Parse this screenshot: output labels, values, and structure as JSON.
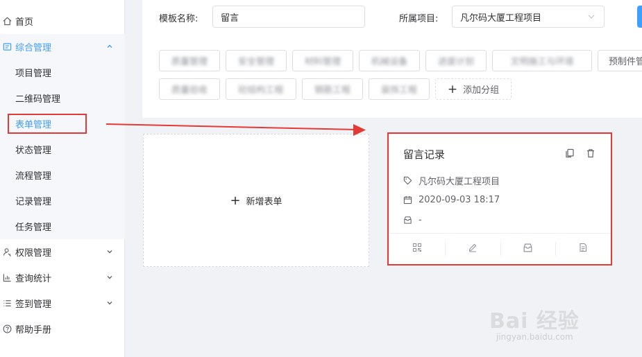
{
  "sidebar": {
    "items": [
      {
        "name": "home",
        "label": "首页",
        "icon": "home-icon"
      },
      {
        "name": "general-management",
        "label": "综合管理",
        "icon": "grid-icon",
        "expanded": true
      },
      {
        "name": "permission-management",
        "label": "权限管理",
        "icon": "user-key-icon"
      },
      {
        "name": "query-statistics",
        "label": "查询统计",
        "icon": "bar-chart-icon"
      },
      {
        "name": "checkin-management",
        "label": "签到管理",
        "icon": "list-icon"
      },
      {
        "name": "help-manual",
        "label": "帮助手册",
        "icon": "question-icon"
      }
    ],
    "sub_items": [
      {
        "label": "项目管理"
      },
      {
        "label": "二维码管理"
      },
      {
        "label": "表单管理",
        "active": true
      },
      {
        "label": "状态管理"
      },
      {
        "label": "流程管理"
      },
      {
        "label": "记录管理"
      },
      {
        "label": "任务管理"
      }
    ]
  },
  "filter": {
    "template_name_label": "模板名称:",
    "template_name_value": "留言",
    "project_label": "所属项目:",
    "project_value": "凡尔码大厦工程项目"
  },
  "tags": [
    {
      "label": "质量管理",
      "blurred": true
    },
    {
      "label": "安全管理",
      "blurred": true
    },
    {
      "label": "材料管理",
      "blurred": true
    },
    {
      "label": "机械设备",
      "blurred": true
    },
    {
      "label": "进度计划",
      "blurred": true
    },
    {
      "label": "文明施工与环境",
      "blurred": true
    },
    {
      "label": "预制件管",
      "blurred": false
    },
    {
      "label": "质量验收",
      "blurred": true
    },
    {
      "label": "砼结构工程",
      "blurred": true
    },
    {
      "label": "钢筋工程",
      "blurred": true
    },
    {
      "label": "装饰工程",
      "blurred": true
    },
    {
      "label": "添加分组",
      "add": true
    }
  ],
  "new_form": {
    "label": "新增表单"
  },
  "form_card": {
    "title": "留言记录",
    "project": "凡尔码大厦工程项目",
    "datetime": "2020-09-03 18:17",
    "status": "-"
  },
  "watermark": {
    "text": "Bai 经验",
    "sub": "jingyan.baidu.com"
  },
  "colors": {
    "accent": "#409eff",
    "highlight": "#e53935"
  }
}
